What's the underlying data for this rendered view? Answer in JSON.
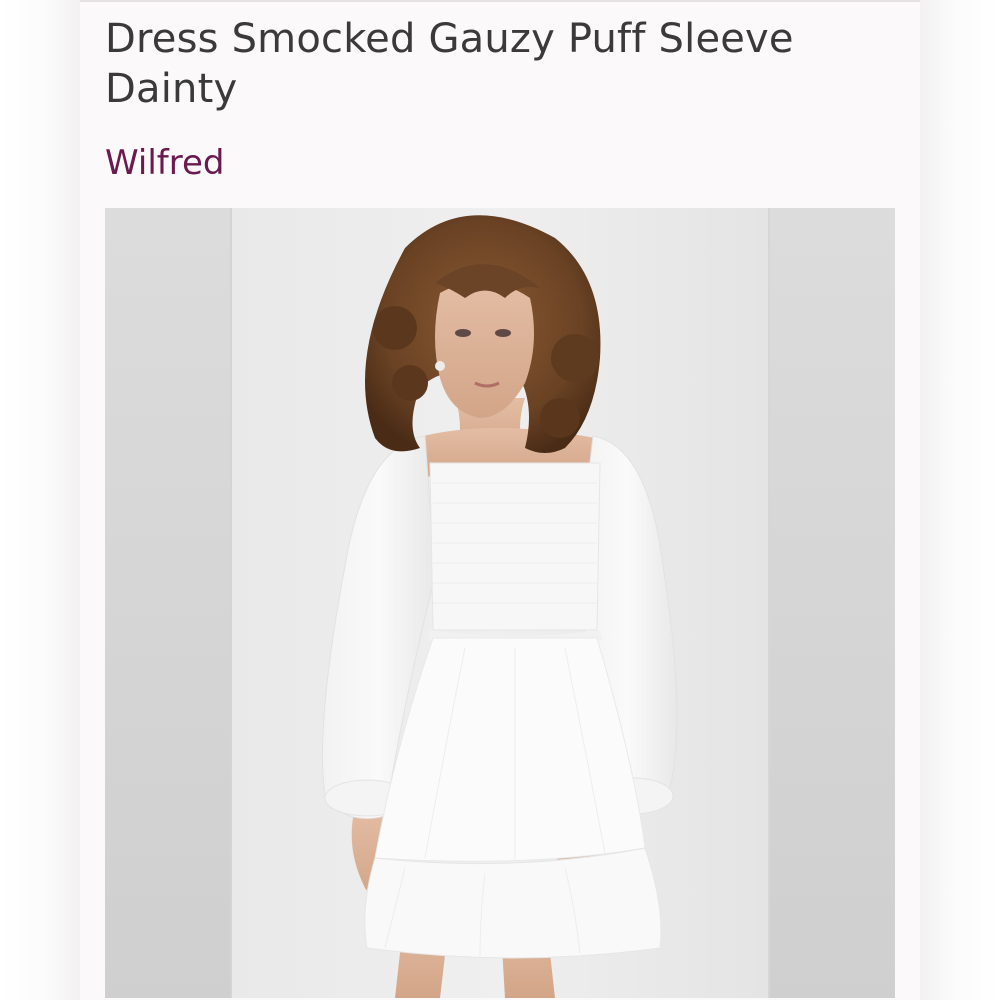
{
  "listing": {
    "title": "Dress Smocked Gauzy Puff Sleeve Dainty",
    "brand": "Wilfred",
    "brand_color": "#6b1a4f",
    "photo_icon": "product-photo"
  }
}
